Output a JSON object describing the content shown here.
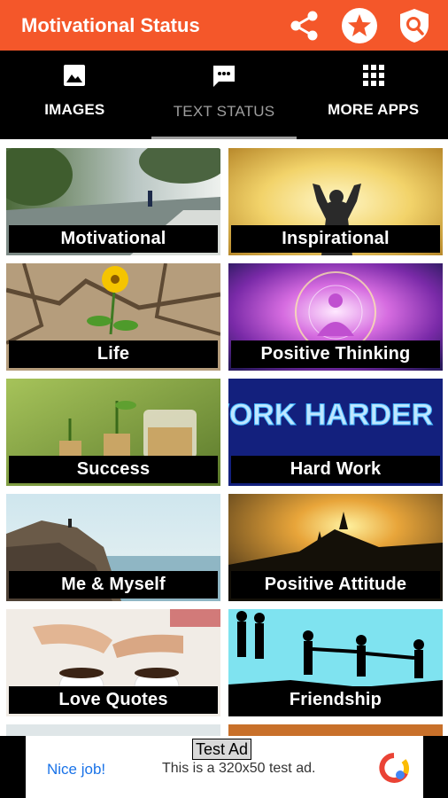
{
  "app_bar": {
    "title": "Motivational Status",
    "actions": [
      "share-icon",
      "star-badge-icon",
      "shield-search-icon"
    ],
    "color": "#f4572a"
  },
  "tabs": [
    {
      "label": "IMAGES",
      "icon": "image-icon",
      "active": false
    },
    {
      "label": "TEXT STATUS",
      "icon": "chat-icon",
      "active": true
    },
    {
      "label": "MORE APPS",
      "icon": "apps-grid-icon",
      "active": false
    }
  ],
  "categories": [
    {
      "label": "Motivational"
    },
    {
      "label": "Inspirational"
    },
    {
      "label": "Life"
    },
    {
      "label": "Positive Thinking"
    },
    {
      "label": "Success"
    },
    {
      "label": "Hard Work"
    },
    {
      "label": "Me & Myself"
    },
    {
      "label": "Positive Attitude"
    },
    {
      "label": "Love Quotes"
    },
    {
      "label": "Friendship"
    }
  ],
  "card_art_text": {
    "work_harder": "WORK HARDER"
  },
  "ad": {
    "badge": "Test Ad",
    "nice_job": "Nice job!",
    "text": "This is a 320x50 test ad."
  }
}
